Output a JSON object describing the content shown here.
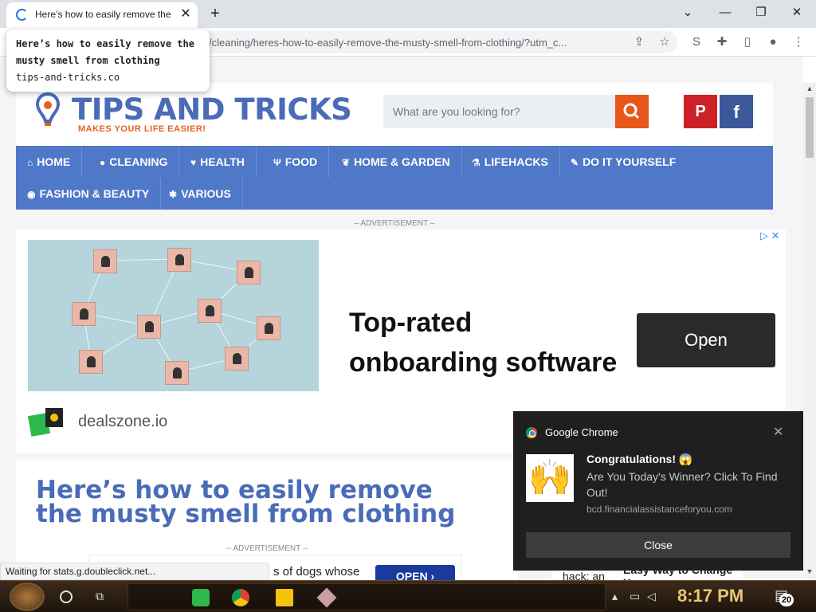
{
  "browser": {
    "tab_title": "Here’s how to easily remove the musty smell from clothing",
    "tab_close": "✕",
    "new_tab": "+",
    "url": "/cleaning/heres-how-to-easily-remove-the-musty-smell-from-clothing/?utm_c...",
    "tooltip_title": "Here’s how to easily remove the musty smell from clothing",
    "tooltip_url": "tips-and-tricks.co",
    "status": "Waiting for stats.g.doubleclick.net..."
  },
  "site": {
    "logo_title": "TIPS AND TRICKS",
    "logo_tagline": "MAKES YOUR LIFE EASIER!",
    "search_placeholder": "What are you looking for?",
    "pinterest": "P",
    "facebook": "f",
    "nav": [
      {
        "label": "HOME",
        "icon": "home-icon",
        "glyph": "⌂"
      },
      {
        "label": "CLEANING",
        "icon": "drop-icon",
        "glyph": "●"
      },
      {
        "label": "HEALTH",
        "icon": "heart-icon",
        "glyph": "♥"
      },
      {
        "label": "FOOD",
        "icon": "fork-icon",
        "glyph": "Ψ"
      },
      {
        "label": "HOME & GARDEN",
        "icon": "leaf-icon",
        "glyph": "❦"
      },
      {
        "label": "LIFEHACKS",
        "icon": "flask-icon",
        "glyph": "⚗"
      },
      {
        "label": "DO IT YOURSELF",
        "icon": "wrench-icon",
        "glyph": "✎"
      },
      {
        "label": "FASHION & BEAUTY",
        "icon": "eye-icon",
        "glyph": "◉"
      },
      {
        "label": "VARIOUS",
        "icon": "asterisk-icon",
        "glyph": "✱"
      }
    ]
  },
  "ad": {
    "label": "– ADVERTISEMENT –",
    "headline_line1": "Top-rated",
    "headline_line2": "onboarding software",
    "cta": "Open",
    "brand": "dealszone.io",
    "choices": "▷ ✕"
  },
  "article": {
    "title": "Here’s how to easily remove the musty smell from clothing",
    "ad_label": "-- ADVERTISEMENT --",
    "ad2_text": "s of dogs whose",
    "ad2_cta": "OPEN ›",
    "side_s1": "hack: an",
    "side_s2": "Easy Way to Change Your"
  },
  "notification": {
    "app": "Google Chrome",
    "close_x": "✕",
    "title": "Congratulations! 😱",
    "body": "Are You Today's Winner? Click To Find Out!",
    "source": "bcd.financialassistanceforyou.com",
    "close_button": "Close",
    "image_glyph": "🙌"
  },
  "taskbar": {
    "time": "8:17 PM",
    "notifications_count": "20"
  }
}
